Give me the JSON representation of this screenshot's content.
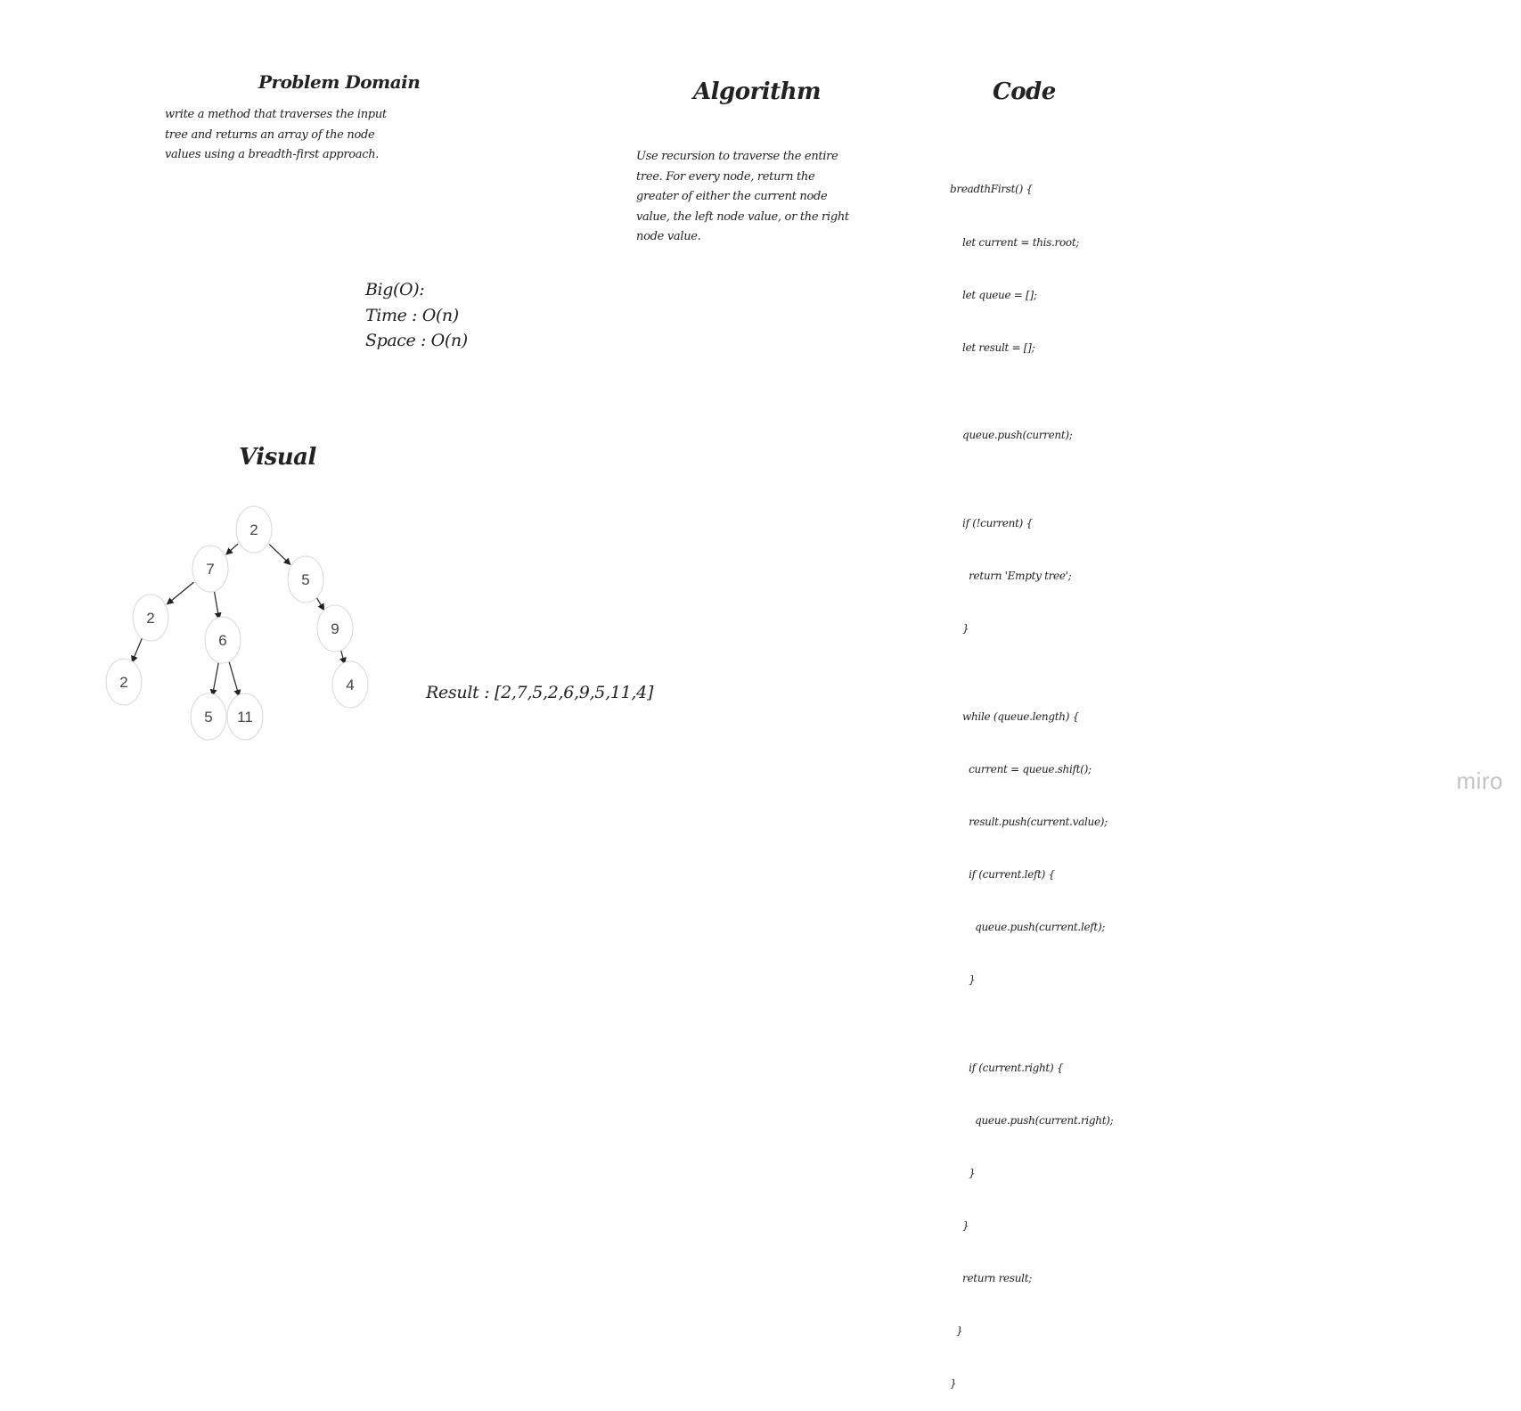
{
  "problem_domain": {
    "title": "Problem Domain",
    "lines": [
      "write a method that traverses the input",
      "tree and returns an array of the node",
      "values using a breadth-first approach."
    ]
  },
  "algorithm": {
    "title": "Algorithm",
    "lines": [
      "Use recursion to traverse the entire",
      "tree. For every node, return the",
      "greater of either the current node",
      "value, the left node value, or the right",
      "node value."
    ]
  },
  "code": {
    "title": "Code",
    "lines": [
      "breadthFirst() {",
      "    let current = this.root;",
      "    let queue = [];",
      "    let result = [];",
      "",
      "    queue.push(current);",
      "",
      "    if (!current) {",
      "      return 'Empty tree';",
      "    }",
      "",
      "    while (queue.length) {",
      "      current = queue.shift();",
      "      result.push(current.value);",
      "      if (current.left) {",
      "        queue.push(current.left);",
      "      }",
      "",
      "      if (current.right) {",
      "        queue.push(current.right);",
      "      }",
      "    }",
      "    return result;",
      "  }",
      "}"
    ]
  },
  "big_o": {
    "lines": [
      "Big(O):",
      "Time : O(n)",
      "Space : O(n)"
    ]
  },
  "visual": {
    "title": "Visual",
    "nodes": [
      {
        "id": "n1",
        "label": "2"
      },
      {
        "id": "n2",
        "label": "7"
      },
      {
        "id": "n3",
        "label": "5"
      },
      {
        "id": "n4",
        "label": "2"
      },
      {
        "id": "n5",
        "label": "6"
      },
      {
        "id": "n6",
        "label": "9"
      },
      {
        "id": "n7",
        "label": "2"
      },
      {
        "id": "n8",
        "label": "5"
      },
      {
        "id": "n9",
        "label": "11"
      },
      {
        "id": "n10",
        "label": "4"
      }
    ],
    "edges": [
      {
        "from": "n1",
        "to": "n2"
      },
      {
        "from": "n1",
        "to": "n3"
      },
      {
        "from": "n2",
        "to": "n4"
      },
      {
        "from": "n2",
        "to": "n5"
      },
      {
        "from": "n3",
        "to": "n6"
      },
      {
        "from": "n4",
        "to": "n7"
      },
      {
        "from": "n5",
        "to": "n8"
      },
      {
        "from": "n5",
        "to": "n9"
      },
      {
        "from": "n6",
        "to": "n10"
      }
    ]
  },
  "result_text": "Result : [2,7,5,2,6,9,5,11,4]",
  "watermark": "miro"
}
